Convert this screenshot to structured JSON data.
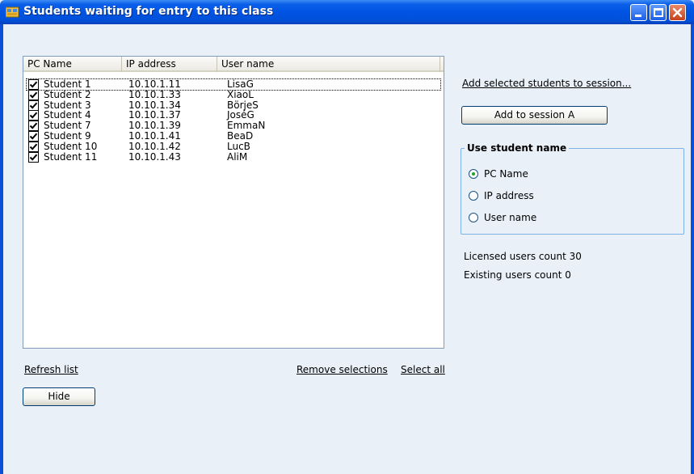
{
  "window": {
    "title": "Students waiting for entry to this class"
  },
  "list": {
    "columns": [
      "PC Name",
      "IP address",
      "User name"
    ],
    "rows": [
      {
        "pc": "Student  1",
        "ip": "10.10.1.11",
        "user": "LisaG",
        "checked": true
      },
      {
        "pc": "Student  2",
        "ip": "10.10.1.33",
        "user": "XiaoL",
        "checked": true
      },
      {
        "pc": "Student  3",
        "ip": "10.10.1.34",
        "user": "BörjeS",
        "checked": true
      },
      {
        "pc": "Student  4",
        "ip": "10.10.1.37",
        "user": "JoséG",
        "checked": true
      },
      {
        "pc": "Student  7",
        "ip": "10.10.1.39",
        "user": "EmmaN",
        "checked": true
      },
      {
        "pc": "Student  9",
        "ip": "10.10.1.41",
        "user": "BeaD",
        "checked": true
      },
      {
        "pc": "Student  10",
        "ip": "10.10.1.42",
        "user": "LucB",
        "checked": true
      },
      {
        "pc": "Student  11",
        "ip": "10.10.1.43",
        "user": "AliM",
        "checked": true
      }
    ]
  },
  "links": {
    "refresh": "Refresh list",
    "remove_selections": "Remove selections",
    "select_all": "Select all",
    "add_selected": "Add selected students to session..."
  },
  "buttons": {
    "hide": "Hide",
    "add_to_session": "Add to session A"
  },
  "name_group": {
    "title": "Use student name",
    "options": [
      "PC Name",
      "IP address",
      "User name"
    ],
    "selected": "PC Name"
  },
  "info": {
    "licensed": "Licensed users count 30",
    "existing": "Existing users count 0"
  },
  "colors": {
    "titlebar": "#0054e3",
    "background": "#e9f0f8",
    "groupbox_border": "#7fb2e4"
  }
}
